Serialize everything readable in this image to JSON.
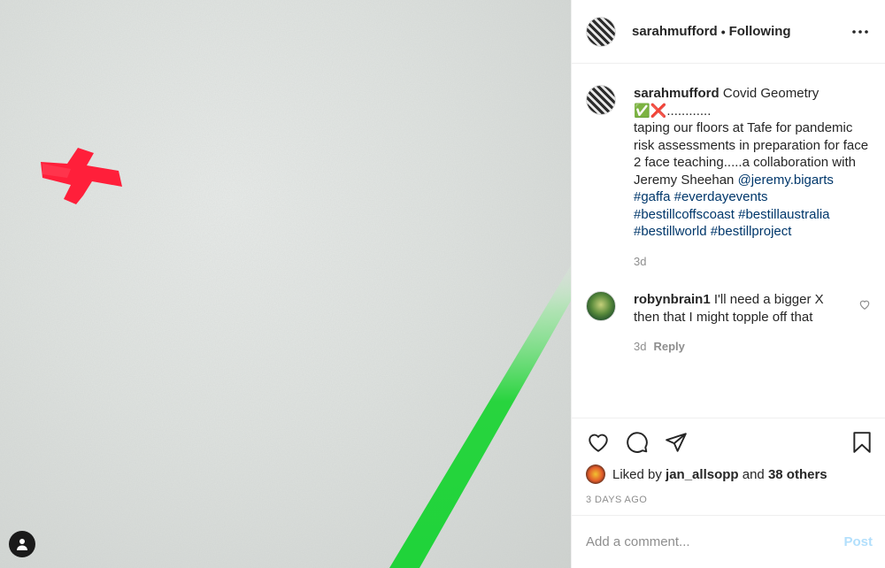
{
  "header": {
    "username": "sarahmufford",
    "separator": "•",
    "follow_status": "Following",
    "more_icon": "ellipsis-icon"
  },
  "caption": {
    "username": "sarahmufford",
    "title": "Covid Geometry",
    "emoji": "✅❌",
    "dots": "............",
    "text": "taping our floors at Tafe for pandemic risk assessments in preparation for face 2 face teaching.....a collaboration with Jeremy Sheehan",
    "mention": "@jeremy.bigarts",
    "hashtags": [
      "#gaffa",
      "#everdayevents",
      "#bestillcoffscoast",
      "#bestillaustralia",
      "#bestillworld",
      "#bestillproject"
    ],
    "age": "3d"
  },
  "comments": [
    {
      "username": "robynbrain1",
      "text": "I'll need a bigger X then that I might topple off that",
      "age": "3d",
      "reply_label": "Reply"
    }
  ],
  "actions": {
    "icons": [
      "heart-icon",
      "comment-icon",
      "share-icon",
      "bookmark-icon"
    ]
  },
  "likes": {
    "prefix": "Liked by",
    "user": "jan_allsopp",
    "conj": "and",
    "others": "38 others"
  },
  "posted": "3 DAYS AGO",
  "add_comment": {
    "placeholder": "Add a comment...",
    "post_label": "Post"
  },
  "colors": {
    "link": "#00376b",
    "muted": "#8e8e8e",
    "post_disabled": "#b2dffc",
    "tape_red": "#ff1f3a",
    "tape_green": "#1fd33a"
  }
}
